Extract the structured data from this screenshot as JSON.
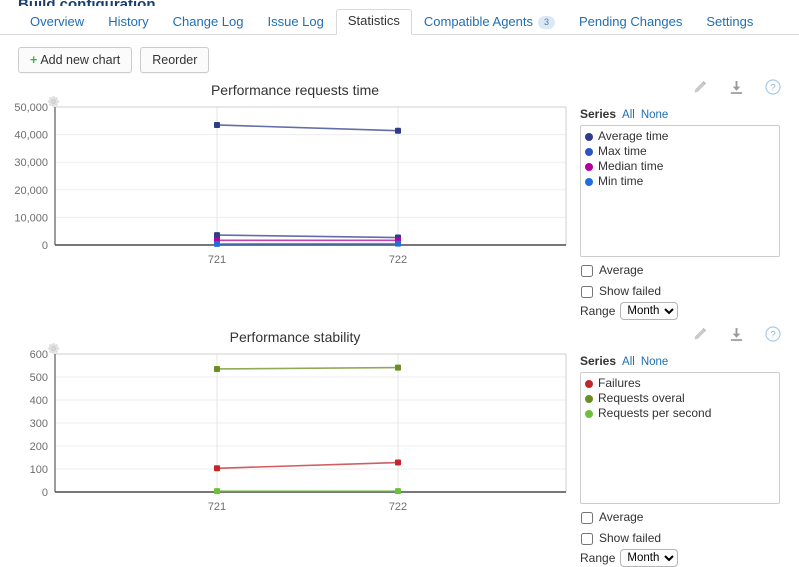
{
  "page": {
    "heading_truncated": "Build configuration"
  },
  "tabs": [
    {
      "label": "Overview",
      "active": false,
      "badge": null
    },
    {
      "label": "History",
      "active": false,
      "badge": null
    },
    {
      "label": "Change Log",
      "active": false,
      "badge": null
    },
    {
      "label": "Issue Log",
      "active": false,
      "badge": null
    },
    {
      "label": "Statistics",
      "active": true,
      "badge": null
    },
    {
      "label": "Compatible Agents",
      "active": false,
      "badge": "3"
    },
    {
      "label": "Pending Changes",
      "active": false,
      "badge": null
    },
    {
      "label": "Settings",
      "active": false,
      "badge": null
    }
  ],
  "toolbar": {
    "add_chart_label": "Add new chart",
    "add_chart_plus": "+",
    "reorder_label": "Reorder"
  },
  "icons": {
    "gear": "gear-icon",
    "edit": "pencil-icon",
    "download": "download-icon",
    "help": "help-icon"
  },
  "legend_common": {
    "series_label": "Series",
    "all_label": "All",
    "none_label": "None",
    "average_label": "Average",
    "show_failed_label": "Show failed",
    "range_label": "Range",
    "range_value": "Month",
    "range_options": [
      "Month"
    ]
  },
  "charts": [
    {
      "title": "Performance requests time",
      "series": [
        {
          "label": "Average time",
          "color": "#2f3c8c"
        },
        {
          "label": "Max time",
          "color": "#2b55c7"
        },
        {
          "label": "Median time",
          "color": "#b5009b"
        },
        {
          "label": "Min time",
          "color": "#1f6fe0"
        }
      ]
    },
    {
      "title": "Performance stability",
      "series": [
        {
          "label": "Failures",
          "color": "#c1272d"
        },
        {
          "label": "Requests overal",
          "color": "#6b8e23"
        },
        {
          "label": "Requests per second",
          "color": "#6dbf3c"
        }
      ]
    }
  ],
  "chart_data": [
    {
      "type": "line",
      "title": "Performance requests time",
      "xlabel": "",
      "ylabel": "",
      "x": [
        "721",
        "722"
      ],
      "xticklabels": [
        "721",
        "722"
      ],
      "ylim": [
        0,
        50000
      ],
      "yticks": [
        0,
        10000,
        20000,
        30000,
        40000,
        50000
      ],
      "yticklabels": [
        "0",
        "10,000",
        "20,000",
        "30,000",
        "40,000",
        "50,000"
      ],
      "grid": true,
      "legend_position": "right",
      "series": [
        {
          "name": "Max time",
          "color": "#2f3c8c",
          "values": [
            43500,
            41400
          ]
        },
        {
          "name": "Average time",
          "color": "#2f3c8c",
          "values": [
            3600,
            2700
          ]
        },
        {
          "name": "Median time",
          "color": "#b5009b",
          "values": [
            1700,
            1700
          ]
        },
        {
          "name": "Min time",
          "color": "#1f6fe0",
          "values": [
            400,
            500
          ]
        }
      ]
    },
    {
      "type": "line",
      "title": "Performance stability",
      "xlabel": "",
      "ylabel": "",
      "x": [
        "721",
        "722"
      ],
      "xticklabels": [
        "721",
        "722"
      ],
      "ylim": [
        0,
        600
      ],
      "yticks": [
        0,
        100,
        200,
        300,
        400,
        500,
        600
      ],
      "yticklabels": [
        "0",
        "100",
        "200",
        "300",
        "400",
        "500",
        "600"
      ],
      "grid": true,
      "legend_position": "right",
      "series": [
        {
          "name": "Requests overal",
          "color": "#6b8e23",
          "values": [
            535,
            541
          ]
        },
        {
          "name": "Failures",
          "color": "#c1272d",
          "values": [
            103,
            128
          ]
        },
        {
          "name": "Requests per second",
          "color": "#6dbf3c",
          "values": [
            4,
            4
          ]
        }
      ]
    }
  ]
}
